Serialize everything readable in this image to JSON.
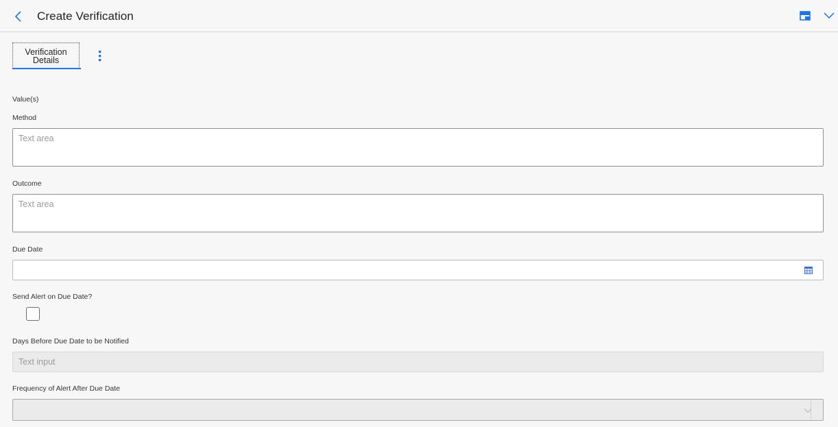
{
  "header": {
    "title": "Create Verification",
    "back_icon": "chevron-left-icon",
    "panel_icon": "panel-icon",
    "collapse_icon": "chevron-down-icon"
  },
  "tabs": [
    {
      "label_line1": "Verification",
      "label_line2": "Details",
      "active": true
    }
  ],
  "more_icon": "more-vertical-icon",
  "form": {
    "section_label": "Value(s)",
    "method": {
      "label": "Method",
      "placeholder": "Text area",
      "value": ""
    },
    "outcome": {
      "label": "Outcome",
      "placeholder": "Text area",
      "value": ""
    },
    "due_date": {
      "label": "Due Date",
      "value": "",
      "icon": "calendar-icon"
    },
    "send_alert": {
      "label": "Send Alert on Due Date?",
      "checked": false
    },
    "days_before": {
      "label": "Days Before Due Date to be Notified",
      "placeholder": "Text input",
      "value": ""
    },
    "frequency": {
      "label": "Frequency of Alert After Due Date",
      "value": "",
      "icon": "chevron-down-icon"
    }
  },
  "colors": {
    "accent": "#1a73e8",
    "background": "#f7f7f7",
    "disabled_field": "#ebebeb"
  }
}
